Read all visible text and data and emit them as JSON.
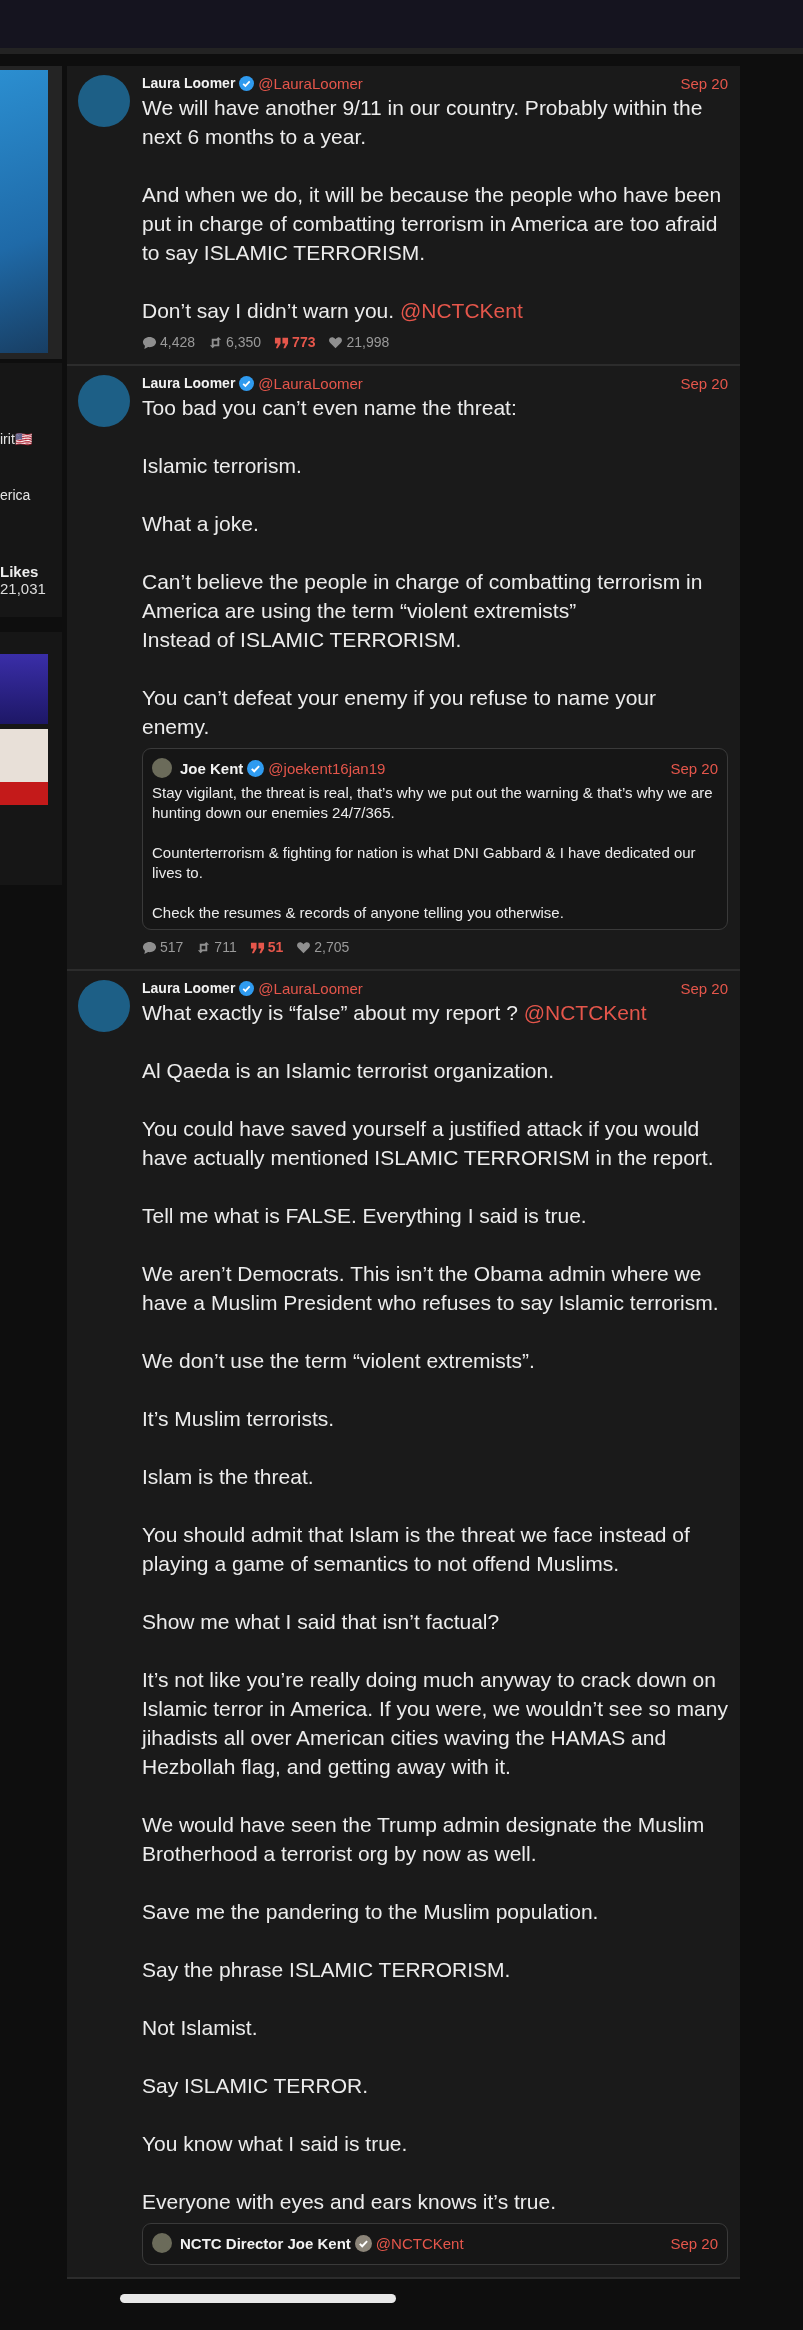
{
  "sidebar": {
    "texts": [
      {
        "kind": "bio",
        "text": "irit🇺🇸"
      },
      {
        "kind": "bio",
        "text": "erica"
      },
      {
        "kind": "label",
        "text": "Likes"
      },
      {
        "kind": "value",
        "text": "21,031"
      }
    ]
  },
  "posts": [
    {
      "author": "Laura Loomer",
      "verified": true,
      "color": "#2f9bf0",
      "handle": "@LauraLoomer",
      "date": "Sep 20",
      "paragraphs": [
        {
          "text": "We will have another 9/11 in our country. Probably within the next 6 months to a year."
        },
        {
          "text": "And when we do, it will be because the people who have been put in charge of combatting terrorism in America are too afraid to say ISLAMIC TERRORISM."
        },
        {
          "text": "Don’t say I didn’t warn you.",
          "mention": "@NCTCKent"
        }
      ],
      "stats": {
        "replies": "4,428",
        "retweets": "6,350",
        "quotes": "773",
        "likes": "21,998"
      }
    },
    {
      "author": "Laura Loomer",
      "verified": true,
      "color": "#2f9bf0",
      "handle": "@LauraLoomer",
      "date": "Sep 20",
      "paragraphs": [
        {
          "text": "Too bad you can’t even name the threat:"
        },
        {
          "text": "Islamic terrorism."
        },
        {
          "text": "What a joke."
        },
        {
          "text": "Can’t believe the people in charge of combatting terrorism in America are using the term “violent extremists”\nInstead of ISLAMIC TERRORISM."
        },
        {
          "text": "You can’t defeat your enemy if you refuse to name your enemy."
        }
      ],
      "quote": {
        "author": "Joe Kent",
        "verified": true,
        "color": "#2f9bf0",
        "handle": "@joekent16jan19",
        "date": "Sep 20",
        "paragraphs": [
          {
            "text": "Stay vigilant, the threat is real, that’s why we put out the warning & that’s why we are hunting down our enemies 24/7/365."
          },
          {
            "text": "Counterterrorism & fighting for nation is what DNI Gabbard & I have dedicated our lives to."
          },
          {
            "text": "Check the resumes & records of anyone telling you otherwise."
          }
        ]
      },
      "stats": {
        "replies": "517",
        "retweets": "711",
        "quotes": "51",
        "likes": "2,705"
      }
    },
    {
      "author": "Laura Loomer",
      "verified": true,
      "color": "#2f9bf0",
      "handle": "@LauraLoomer",
      "date": "Sep 20",
      "paragraphs": [
        {
          "text": "What exactly is “false” about my report ?",
          "mention": "@NCTCKent"
        },
        {
          "text": "Al Qaeda is an Islamic terrorist organization."
        },
        {
          "text": "You could have saved yourself a justified attack if you would have actually mentioned ISLAMIC TERRORISM in the report."
        },
        {
          "text": "Tell me what is FALSE. Everything I said is true."
        },
        {
          "text": "We aren’t Democrats. This isn’t the Obama admin where we have a Muslim President who refuses to say Islamic terrorism."
        },
        {
          "text": "We don’t use the term “violent extremists”."
        },
        {
          "text": "It’s Muslim terrorists."
        },
        {
          "text": "Islam is the threat."
        },
        {
          "text": "You should admit that Islam is the threat we face instead of playing a game of semantics to not offend Muslims."
        },
        {
          "text": "Show me what I said that isn’t factual?"
        },
        {
          "text": "It’s not like you’re really doing much anyway to crack down on Islamic terror in America. If you were, we wouldn’t see so many jihadists all over American cities waving the HAMAS and Hezbollah flag, and getting away with it."
        },
        {
          "text": "We would have seen the Trump admin designate the Muslim Brotherhood a terrorist org by now as well."
        },
        {
          "text": "Save me the pandering to the Muslim population."
        },
        {
          "text": "Say the phrase ISLAMIC TERRORISM."
        },
        {
          "text": "Not Islamist."
        },
        {
          "text": "Say ISLAMIC TERROR."
        },
        {
          "text": "You know what I said is true."
        },
        {
          "text": "Everyone with eyes and ears knows it’s true."
        }
      ],
      "quote": {
        "author": "NCTC Director Joe Kent",
        "verified": true,
        "color": "#8c8579",
        "handle": "@NCTCKent",
        "date": "Sep 20"
      }
    }
  ]
}
